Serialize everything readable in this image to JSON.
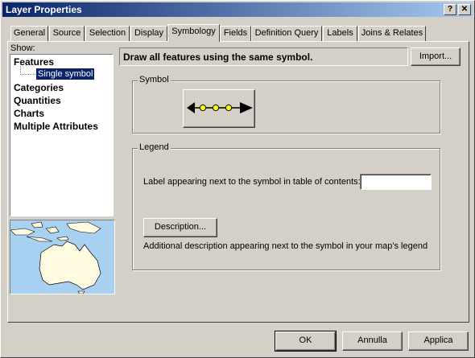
{
  "window": {
    "title": "Layer Properties"
  },
  "titlebar_buttons": {
    "help": "?",
    "close": "✕"
  },
  "tabs": [
    {
      "label": "General",
      "active": false
    },
    {
      "label": "Source",
      "active": false
    },
    {
      "label": "Selection",
      "active": false
    },
    {
      "label": "Display",
      "active": false
    },
    {
      "label": "Symbology",
      "active": true
    },
    {
      "label": "Fields",
      "active": false
    },
    {
      "label": "Definition Query",
      "active": false
    },
    {
      "label": "Labels",
      "active": false
    },
    {
      "label": "Joins & Relates",
      "active": false
    }
  ],
  "show": {
    "label": "Show:",
    "items": [
      "Features",
      "Single symbol",
      "Categories",
      "Quantities",
      "Charts",
      "Multiple Attributes"
    ],
    "selected": "Single symbol"
  },
  "main": {
    "heading": "Draw all features using the same symbol.",
    "import_label": "Import..."
  },
  "symbol_group": {
    "title": "Symbol",
    "icon": "arrow-line-with-dots-symbol",
    "dot_color": "#ffff00"
  },
  "legend_group": {
    "title": "Legend",
    "toc_label": "Label appearing next to the symbol in table of contents:",
    "toc_value": "",
    "description_button": "Description...",
    "description_text": "Additional description appearing next to the symbol in your map's legend"
  },
  "footer": {
    "ok": "OK",
    "cancel": "Annulla",
    "apply": "Applica"
  },
  "colors": {
    "titlebar_start": "#0a246a",
    "titlebar_end": "#a6caf0",
    "map_sea": "#a8d0f0",
    "map_land": "#fffbe0"
  }
}
